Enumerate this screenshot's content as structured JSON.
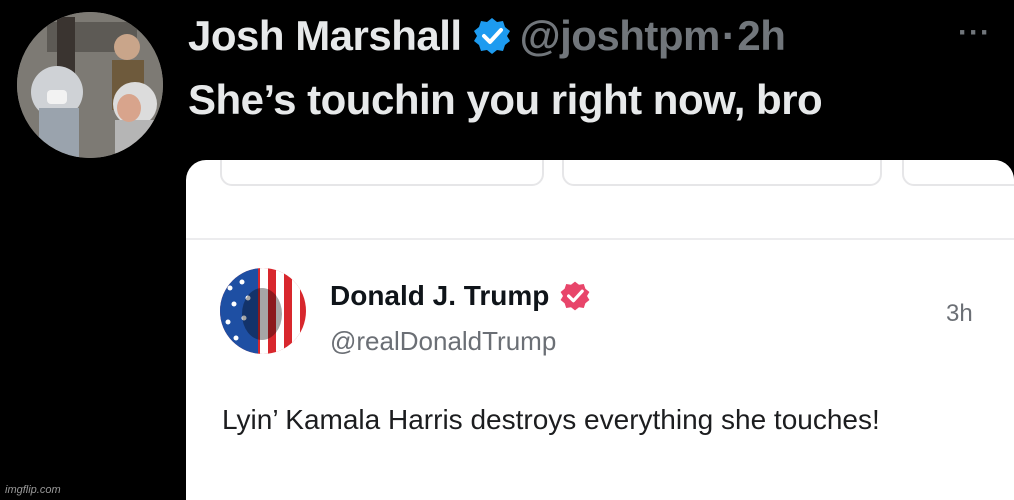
{
  "tweet": {
    "author_name": "Josh Marshall",
    "handle": "@joshtpm",
    "separator": "·",
    "time": "2h",
    "more_icon": "ellipsis-icon",
    "text": "She’s touchin you right now, bro",
    "verified_color": "#1d9bf0"
  },
  "quoted_post": {
    "author_name": "Donald J. Trump",
    "handle": "@realDonaldTrump",
    "time": "3h",
    "text": "Lyin’ Kamala Harris destroys everything she touches!",
    "verified_color": "#e8456a"
  },
  "watermark": "imgflip.com"
}
